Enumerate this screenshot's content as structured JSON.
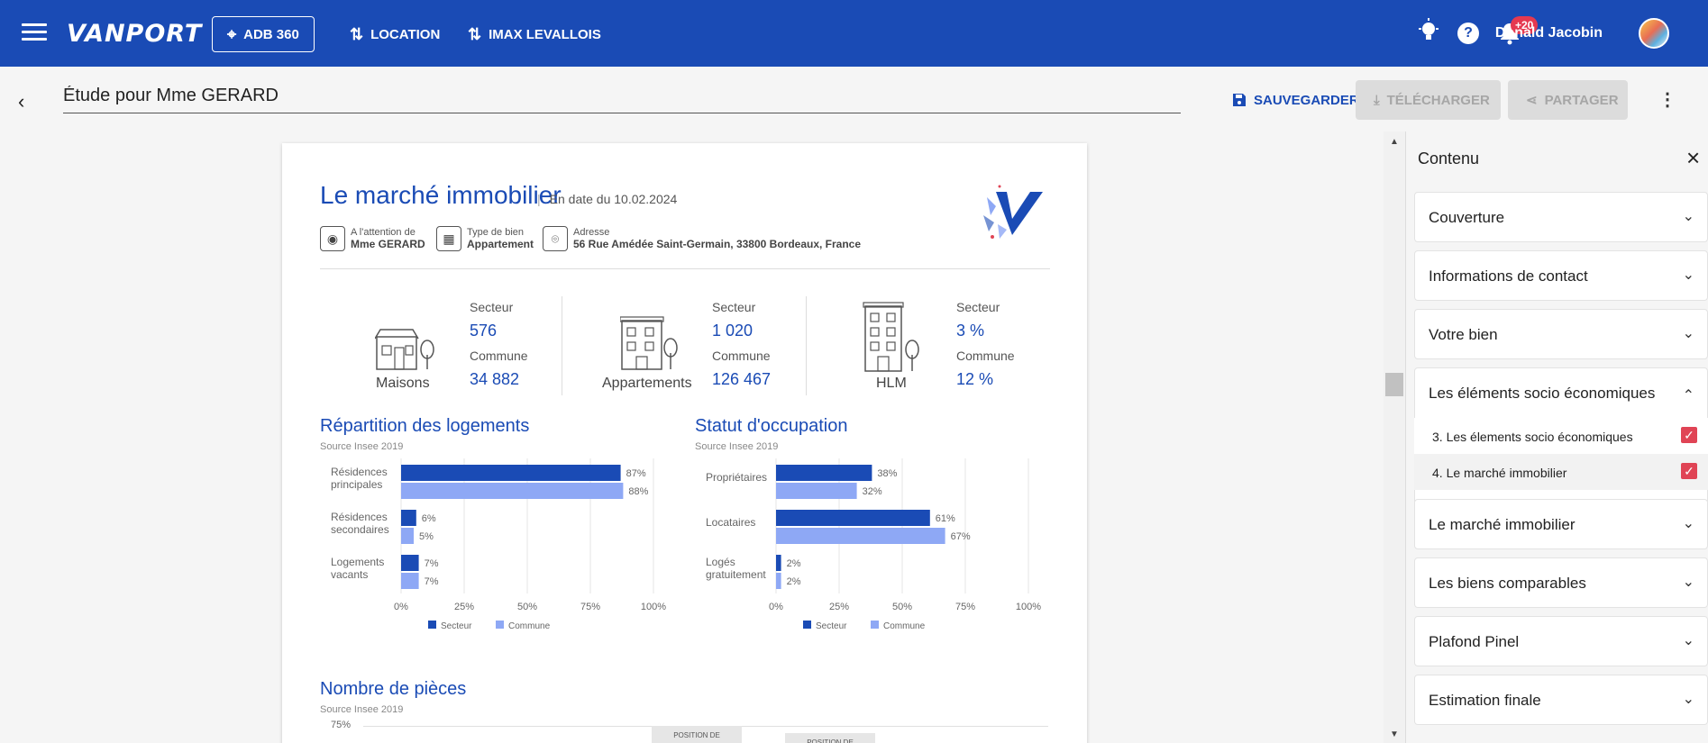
{
  "topbar": {
    "logo": "VANPORT",
    "adb_label": "ADB 360",
    "location_label": "LOCATION",
    "imax_label": "IMAX LEVALLOIS",
    "notif_badge": "+20",
    "user_name": "Donald Jacobin",
    "icons": [
      "menu-icon",
      "crosshair-icon",
      "sort-icon",
      "lightbulb-icon",
      "help-icon",
      "bell-icon"
    ]
  },
  "subbar": {
    "study_title": "Étude pour Mme GERARD",
    "save_label": "SAUVEGARDER",
    "download_label": "TÉLÉCHARGER",
    "share_label": "PARTAGER"
  },
  "document": {
    "title": "Le marché immobilier",
    "date": "En date du 10.02.2024",
    "attention_label": "A l'attention de",
    "attention_value": "Mme GERARD",
    "type_label": "Type de bien",
    "type_value": "Appartement",
    "address_label": "Adresse",
    "address_value": "56 Rue Amédée Saint-Germain, 33800 Bordeaux, France",
    "stats": [
      {
        "name": "Maisons",
        "secteur_label": "Secteur",
        "secteur": "576",
        "commune_label": "Commune",
        "commune": "34 882"
      },
      {
        "name": "Appartements",
        "secteur_label": "Secteur",
        "secteur": "1 020",
        "commune_label": "Commune",
        "commune": "126 467"
      },
      {
        "name": "HLM",
        "secteur_label": "Secteur",
        "secteur": "3 %",
        "commune_label": "Commune",
        "commune": "12 %"
      }
    ],
    "repartition_title": "Répartition des logements",
    "occupation_title": "Statut d'occupation",
    "pieces_title": "Nombre de pièces",
    "source": "Source Insee 2019",
    "pieces_ytick": "75%",
    "pieces_tag_1": "POSITION DE",
    "pieces_tag_2": "POSITION DE"
  },
  "colors": {
    "brand": "#1a4bb5",
    "secteur": "#1a4bb5",
    "commune": "#8ea8f5",
    "check": "#e04455"
  },
  "chart_data": [
    {
      "type": "bar",
      "orientation": "horizontal",
      "title": "Répartition des logements",
      "categories": [
        [
          "Résidences",
          "principales"
        ],
        [
          "Résidences",
          "secondaires"
        ],
        [
          "Logements",
          "vacants"
        ]
      ],
      "series": [
        {
          "name": "Secteur",
          "values": [
            87,
            6,
            7
          ]
        },
        {
          "name": "Commune",
          "values": [
            88,
            5,
            7
          ]
        }
      ],
      "xticks": [
        "0%",
        "25%",
        "50%",
        "75%",
        "100%"
      ],
      "xlim": [
        0,
        100
      ],
      "legend": "bottom"
    },
    {
      "type": "bar",
      "orientation": "horizontal",
      "title": "Statut d'occupation",
      "categories": [
        [
          "Propriétaires"
        ],
        [
          "Locataires"
        ],
        [
          "Logés",
          "gratuitement"
        ]
      ],
      "series": [
        {
          "name": "Secteur",
          "values": [
            38,
            61,
            2
          ]
        },
        {
          "name": "Commune",
          "values": [
            32,
            67,
            2
          ]
        }
      ],
      "xticks": [
        "0%",
        "25%",
        "50%",
        "75%",
        "100%"
      ],
      "xlim": [
        0,
        100
      ],
      "legend": "bottom"
    }
  ],
  "sidepanel": {
    "title": "Contenu",
    "items": [
      {
        "label": "Couverture",
        "expanded": false
      },
      {
        "label": "Informations de contact",
        "expanded": false
      },
      {
        "label": "Votre bien",
        "expanded": false
      },
      {
        "label": "Les éléments socio économiques",
        "expanded": true
      },
      {
        "label": "Le marché immobilier",
        "expanded": false
      },
      {
        "label": "Les biens comparables",
        "expanded": false
      },
      {
        "label": "Plafond Pinel",
        "expanded": false
      },
      {
        "label": "Estimation finale",
        "expanded": false
      }
    ],
    "sub_items": [
      {
        "label": "3. Les élements socio économiques",
        "checked": true
      },
      {
        "label": "4. Le marché immobilier",
        "checked": true
      }
    ]
  }
}
